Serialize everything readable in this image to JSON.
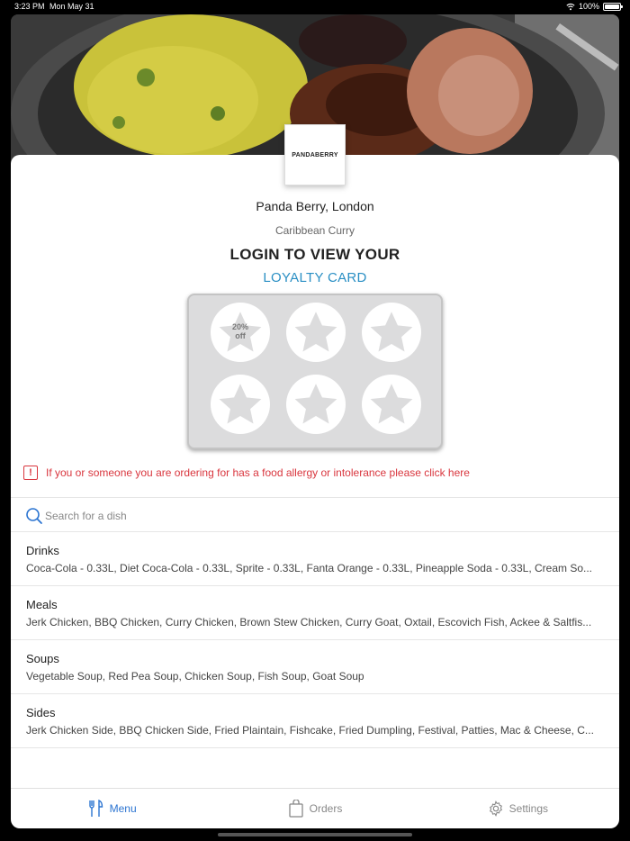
{
  "status_bar": {
    "time": "3:23 PM",
    "date": "Mon May 31",
    "battery": "100%"
  },
  "restaurant": {
    "logo_text": "PANDABERRY",
    "name": "Panda Berry, London",
    "cuisine": "Caribbean Curry"
  },
  "loyalty": {
    "login_title": "LOGIN TO VIEW YOUR",
    "card_title": "LOYALTY CARD",
    "first_stamp_label_line1": "20%",
    "first_stamp_label_line2": "off",
    "stamp_count": 6
  },
  "allergy": {
    "icon": "!",
    "text": "If you or someone you are ordering for has a food allergy or intolerance please click here"
  },
  "search": {
    "placeholder": "Search for a dish"
  },
  "menu": {
    "categories": [
      {
        "title": "Drinks",
        "items": "Coca-Cola - 0.33L, Diet Coca-Cola - 0.33L, Sprite - 0.33L, Fanta Orange - 0.33L, Pineapple Soda - 0.33L, Cream So..."
      },
      {
        "title": "Meals",
        "items": "Jerk Chicken, BBQ Chicken, Curry Chicken, Brown Stew Chicken, Curry Goat, Oxtail, Escovich Fish, Ackee & Saltfis..."
      },
      {
        "title": "Soups",
        "items": "Vegetable Soup, Red Pea Soup, Chicken Soup, Fish Soup, Goat Soup"
      },
      {
        "title": "Sides",
        "items": "Jerk Chicken Side, BBQ Chicken Side, Fried Plaintain, Fishcake, Fried Dumpling, Festival, Patties, Mac & Cheese, C..."
      }
    ]
  },
  "tabs": [
    {
      "label": "Menu",
      "icon": "fork-knife-icon",
      "active": true
    },
    {
      "label": "Orders",
      "icon": "bag-icon",
      "active": false
    },
    {
      "label": "Settings",
      "icon": "gear-icon",
      "active": false
    }
  ],
  "colors": {
    "accent": "#2b74d1",
    "loyalty": "#2a8fc4",
    "warning": "#d9363e"
  }
}
